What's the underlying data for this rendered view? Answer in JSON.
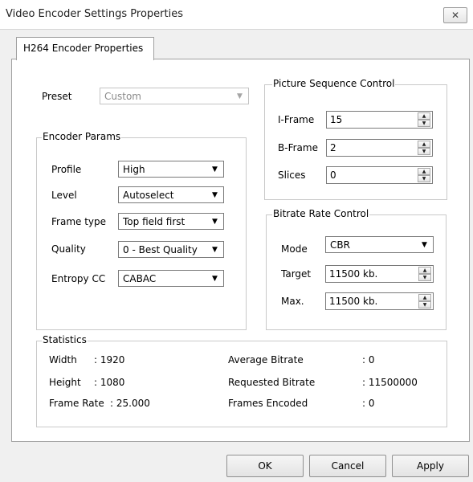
{
  "window": {
    "title": "Video Encoder Settings Properties",
    "close_symbol": "✕"
  },
  "tabs": [
    {
      "label": "H264 Encoder Properties",
      "active": true
    }
  ],
  "preset": {
    "label": "Preset",
    "value": "Custom"
  },
  "encoder_params": {
    "title": "Encoder Params",
    "fields": [
      {
        "label": "Profile",
        "value": "High"
      },
      {
        "label": "Level",
        "value": "Autoselect"
      },
      {
        "label": "Frame type",
        "value": "Top field first"
      },
      {
        "label": "Quality",
        "value": "0 - Best Quality"
      },
      {
        "label": "Entropy CC",
        "value": "CABAC"
      }
    ]
  },
  "picture_sequence": {
    "title": "Picture Sequence Control",
    "fields": [
      {
        "label": "I-Frame",
        "value": "15"
      },
      {
        "label": "B-Frame",
        "value": "2"
      },
      {
        "label": "Slices",
        "value": "0"
      }
    ]
  },
  "bitrate_control": {
    "title": "Bitrate Rate Control",
    "mode": {
      "label": "Mode",
      "value": "CBR"
    },
    "target": {
      "label": "Target",
      "value": "11500 kb."
    },
    "max": {
      "label": "Max.",
      "value": "11500 kb."
    }
  },
  "statistics": {
    "title": "Statistics",
    "left": [
      {
        "label": "Width",
        "value": ": 1920"
      },
      {
        "label": "Height",
        "value": ": 1080"
      },
      {
        "label": "Frame Rate",
        "value": ": 25.000"
      }
    ],
    "right": [
      {
        "label": "Average Bitrate",
        "value": ": 0"
      },
      {
        "label": "Requested Bitrate",
        "value": ": 11500000"
      },
      {
        "label": "Frames Encoded",
        "value": ": 0"
      }
    ]
  },
  "buttons": {
    "ok": "OK",
    "cancel": "Cancel",
    "apply": "Apply"
  },
  "icons": {
    "dropdown": "▼",
    "spin_up": "▲",
    "spin_down": "▼"
  }
}
